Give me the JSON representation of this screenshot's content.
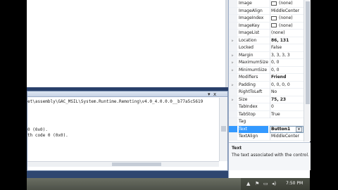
{
  "output": {
    "lines": [
      "et\\assembly\\GAC_MSIL\\System.Runtime.Remoting\\v4.0_4.0.0.0__b77a5c5619",
      "",
      "",
      "",
      "",
      "0 (0x0).",
      "th code 0 (0x0)."
    ],
    "controls": {
      "pin": "▾",
      "close": "x"
    }
  },
  "properties": {
    "rows": [
      {
        "name": "Image",
        "value": "(none)",
        "swatch": true
      },
      {
        "name": "ImageAlign",
        "value": "MiddleCenter"
      },
      {
        "name": "ImageIndex",
        "value": "(none)",
        "swatch": true
      },
      {
        "name": "ImageKey",
        "value": "(none)",
        "swatch": true
      },
      {
        "name": "ImageList",
        "value": "(none)"
      },
      {
        "name": "Location",
        "value": "86, 131",
        "expand": "▹",
        "bold": true
      },
      {
        "name": "Locked",
        "value": "False"
      },
      {
        "name": "Margin",
        "value": "3, 3, 3, 3",
        "expand": "▹"
      },
      {
        "name": "MaximumSize",
        "value": "0, 0",
        "expand": "▹"
      },
      {
        "name": "MinimumSize",
        "value": "0, 0",
        "expand": "▹"
      },
      {
        "name": "Modifiers",
        "value": "Friend",
        "bold": true
      },
      {
        "name": "Padding",
        "value": "0, 0, 0, 0",
        "expand": "▹"
      },
      {
        "name": "RightToLeft",
        "value": "No"
      },
      {
        "name": "Size",
        "value": "75, 23",
        "expand": "▹",
        "bold": true
      },
      {
        "name": "TabIndex",
        "value": "0"
      },
      {
        "name": "TabStop",
        "value": "True"
      },
      {
        "name": "Tag",
        "value": ""
      },
      {
        "name": "Text",
        "value": "Button1",
        "selected": true,
        "bold": true
      },
      {
        "name": "TextAlign",
        "value": "MiddleCenter"
      }
    ],
    "dropdown_glyph": "▾",
    "description": {
      "title": "Text",
      "text": "The text associated with the control."
    }
  },
  "taskbar": {
    "tray_icons": [
      "▲",
      "⚑",
      "▭",
      "◂)"
    ],
    "clock": "7:50 PM"
  },
  "colors": {
    "selection": "#3399ff",
    "taskbar": "#4d5149"
  }
}
